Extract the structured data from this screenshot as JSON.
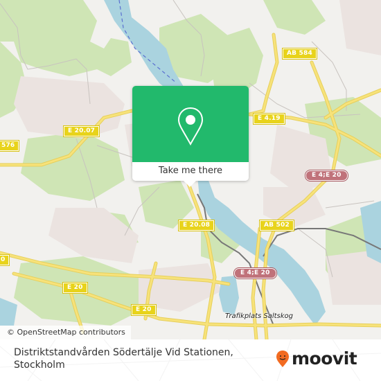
{
  "map": {
    "road_shields": [
      {
        "id": "ab584",
        "label": "AB 584",
        "type": "national"
      },
      {
        "id": "e419",
        "label": "E 4.19",
        "type": "national"
      },
      {
        "id": "e2007",
        "label": "E 20.07",
        "type": "national"
      },
      {
        "id": "n576",
        "label": "576",
        "type": "national"
      },
      {
        "id": "e4e20-east",
        "label": "E 4;E 20",
        "type": "european"
      },
      {
        "id": "e2008",
        "label": "E 20.08",
        "type": "national"
      },
      {
        "id": "ab502",
        "label": "AB 502",
        "type": "national"
      },
      {
        "id": "e4e20-south",
        "label": "E 4;E 20",
        "type": "european"
      },
      {
        "id": "n0-west",
        "label": "0",
        "type": "national"
      },
      {
        "id": "e20-west",
        "label": "E 20",
        "type": "national"
      },
      {
        "id": "e20-south",
        "label": "E 20",
        "type": "national"
      }
    ],
    "place_labels": [
      {
        "label": "Trafikplats Saltskog"
      }
    ],
    "attribution": "© OpenStreetMap contributors",
    "colors": {
      "water": "#aad3df",
      "forest": "#c8e2ad",
      "residential": "#e8e0df",
      "road_major": "#f7e27a",
      "background": "#f2f1ee"
    }
  },
  "popup": {
    "icon": "location-pin-icon",
    "button_label": "Take me there",
    "color": "#22b96c"
  },
  "footer": {
    "title": "Distriktstandvården Södertälje Vid Stationen, Stockholm",
    "brand": "moovit",
    "brand_color": "#f26b21"
  }
}
